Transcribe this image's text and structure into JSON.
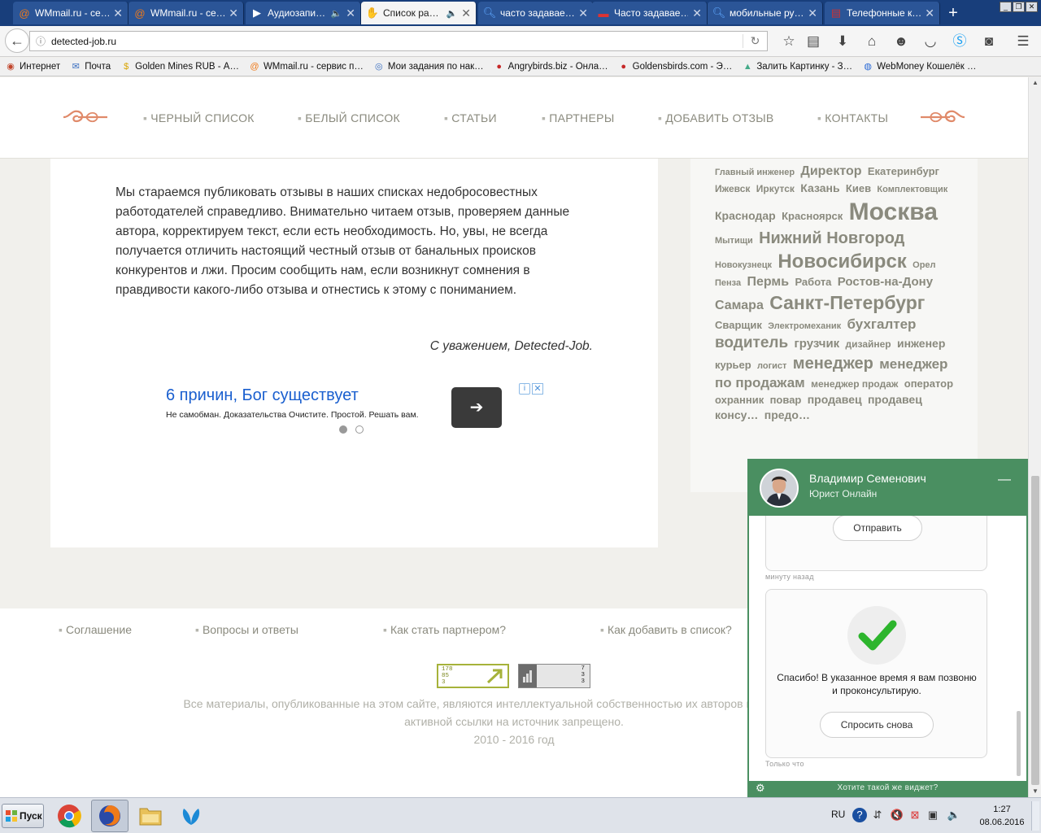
{
  "browser": {
    "tabs": [
      {
        "title": "WMmail.ru - се…",
        "icon": "wmmail-icon",
        "active": false
      },
      {
        "title": "WMmail.ru - се…",
        "icon": "wmmail-icon",
        "active": false
      },
      {
        "title": "Аудиозапи…",
        "icon": "play-icon",
        "active": false,
        "audio": true
      },
      {
        "title": "Список ра…",
        "icon": "hand-icon",
        "active": true,
        "audio": true
      },
      {
        "title": "часто задавае…",
        "icon": "search-icon",
        "active": false
      },
      {
        "title": "Часто задавае…",
        "icon": "flag-icon",
        "active": false
      },
      {
        "title": "мобильные ру…",
        "icon": "search-icon",
        "active": false
      },
      {
        "title": "Телефонные к…",
        "icon": "page-icon",
        "active": false
      }
    ],
    "url": "detected-job.ru",
    "bookmarks": [
      {
        "label": "Интернет",
        "icon": "globe-icon"
      },
      {
        "label": "Почта",
        "icon": "mail-icon"
      },
      {
        "label": "Golden Mines RUB - А…",
        "icon": "coin-icon"
      },
      {
        "label": "WMmail.ru - сервис п…",
        "icon": "wmmail-icon"
      },
      {
        "label": "Мои задания по нак…",
        "icon": "spiral-icon"
      },
      {
        "label": "Angrybirds.biz - Онла…",
        "icon": "bird-icon"
      },
      {
        "label": "Goldensbirds.com - Э…",
        "icon": "bird-icon"
      },
      {
        "label": "Залить Картинку - З…",
        "icon": "image-icon"
      },
      {
        "label": "WebMoney Кошелёк …",
        "icon": "webmoney-icon"
      }
    ]
  },
  "site": {
    "nav": [
      "ЧЕРНЫЙ СПИСОК",
      "БЕЛЫЙ СПИСОК",
      "СТАТЬИ",
      "ПАРТНЕРЫ",
      "ДОБАВИТЬ ОТЗЫВ",
      "КОНТАКТЫ"
    ],
    "article_text": "Мы стараемся публиковать отзывы в наших списках недобросовестных работодателей справедливо. Внимательно читаем отзыв, проверяем данные автора, корректируем текст, если есть необходимость. Но, увы, не всегда получается отличить настоящий честный отзыв от банальных происков конкурентов и лжи. Просим сообщить нам, если возникнут сомнения в правдивости какого-либо отзыва и отнестись к этому с пониманием.",
    "signature": "С уважением, Detected-Job.",
    "ad": {
      "title": "6 причин, Бог существует",
      "description": "Не самобман. Доказательства Очистите. Простой. Решать вам.",
      "button_icon": "arrow-right-icon"
    },
    "tags": [
      {
        "text": "Главный инженер",
        "size": 11
      },
      {
        "text": "Директор",
        "size": 16
      },
      {
        "text": "Екатеринбург",
        "size": 13
      },
      {
        "text": "Ижевск",
        "size": 12
      },
      {
        "text": "Иркутск",
        "size": 12
      },
      {
        "text": "Казань",
        "size": 14
      },
      {
        "text": "Киев",
        "size": 13
      },
      {
        "text": "Комплектовщик",
        "size": 11
      },
      {
        "text": "Краснодар",
        "size": 14
      },
      {
        "text": "Красноярск",
        "size": 13
      },
      {
        "text": "Москва",
        "size": 30
      },
      {
        "text": "Мытищи",
        "size": 11
      },
      {
        "text": "Нижний Новгород",
        "size": 20
      },
      {
        "text": "Новокузнецк",
        "size": 11
      },
      {
        "text": "Новосибирск",
        "size": 24
      },
      {
        "text": "Орел",
        "size": 11
      },
      {
        "text": "Пенза",
        "size": 11
      },
      {
        "text": "Пермь",
        "size": 16
      },
      {
        "text": "Работа",
        "size": 13
      },
      {
        "text": "Ростов-на-Дону",
        "size": 15
      },
      {
        "text": "Самара",
        "size": 16
      },
      {
        "text": "Санкт-Петербург",
        "size": 23
      },
      {
        "text": "Сварщик",
        "size": 13
      },
      {
        "text": "Электромеханик",
        "size": 11
      },
      {
        "text": "бухгалтер",
        "size": 17
      },
      {
        "text": "водитель",
        "size": 19
      },
      {
        "text": "грузчик",
        "size": 15
      },
      {
        "text": "дизайнер",
        "size": 12
      },
      {
        "text": "инженер",
        "size": 14
      },
      {
        "text": "курьер",
        "size": 13
      },
      {
        "text": "логист",
        "size": 11
      },
      {
        "text": "менеджер",
        "size": 20
      },
      {
        "text": "менеджер по продажам",
        "size": 17
      },
      {
        "text": "менеджер продаж",
        "size": 12
      },
      {
        "text": "оператор",
        "size": 13
      },
      {
        "text": "охранник",
        "size": 13
      },
      {
        "text": "повар",
        "size": 13
      },
      {
        "text": "продавец",
        "size": 14
      },
      {
        "text": "продавец консу…",
        "size": 14
      },
      {
        "text": "предо…",
        "size": 14
      }
    ],
    "footer_links": [
      "Соглашение",
      "Вопросы и ответы",
      "Как стать партнером?",
      "Как добавить в список?"
    ],
    "counter1": [
      "178",
      "85",
      "3"
    ],
    "counter2": [
      "7",
      "3",
      "3"
    ],
    "copyright_line1": "Все материалы, опубликованные на этом сайте, являются интеллектуальной собственностью их авторов и редакторов прое",
    "copyright_line2": "активной ссылки на источник запрещено.",
    "copyright_years": "2010 - 2016 год"
  },
  "chat": {
    "name": "Владимир Семенович",
    "role": "Юрист Онлайн",
    "send_label": "Отправить",
    "stamp1": "минуту назад",
    "thanks": "Спасибо! В указанное время я вам позвоню и проконсультирую.",
    "ask_again": "Спросить снова",
    "stamp2": "Только что",
    "footer": "Хотите такой же виджет?",
    "accent": "#4a8f61"
  },
  "taskbar": {
    "start": "Пуск",
    "lang": "RU",
    "time": "1:27",
    "date": "08.06.2016"
  }
}
